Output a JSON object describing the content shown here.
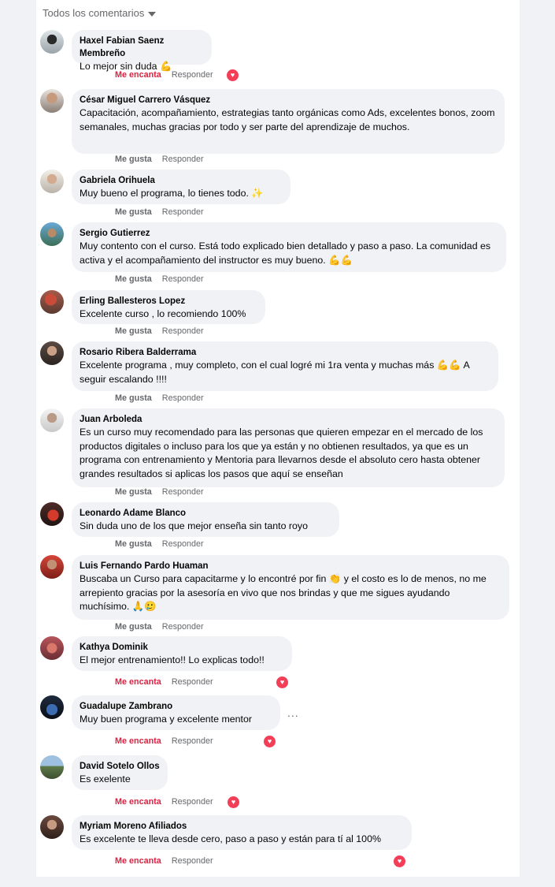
{
  "filter_label": "Todos los comentarios",
  "comments": [
    {
      "author": "Haxel Fabian Saenz Membreño",
      "text": "Lo mejor sin duda 💪",
      "like": "Me encanta",
      "reply": "Responder",
      "reaction": "love"
    },
    {
      "author": "César Miguel Carrero Vásquez",
      "text": "Capacitación, acompañamiento, estrategias tanto orgánicas como Ads, excelentes bonos, zoom semanales, muchas gracias por todo y ser parte del aprendizaje de muchos.",
      "like": "Me gusta",
      "reply": "Responder",
      "reaction": ""
    },
    {
      "author": "Gabriela Orihuela",
      "text": "Muy bueno el programa, lo tienes todo. ✨",
      "like": "Me gusta",
      "reply": "Responder",
      "reaction": ""
    },
    {
      "author": "Sergio Gutierrez",
      "text": "Muy contento con el curso. Está todo explicado bien detallado y paso a paso. La comunidad es activa y el acompañamiento del instructor es muy bueno. 💪💪",
      "like": "Me gusta",
      "reply": "Responder",
      "reaction": ""
    },
    {
      "author": "Erling Ballesteros Lopez",
      "text": "Excelente curso , lo recomiendo 100%",
      "like": "Me gusta",
      "reply": "Responder",
      "reaction": ""
    },
    {
      "author": "Rosario Ribera Balderrama",
      "text": "Excelente programa , muy completo, con el cual logré mi 1ra venta y muchas más 💪💪 A seguir escalando !!!!",
      "like": "Me gusta",
      "reply": "Responder",
      "reaction": ""
    },
    {
      "author": "Juan Arboleda",
      "text": "Es un curso muy recomendado para las personas que quieren empezar en el mercado de los productos digitales o incluso para los que ya están y no obtienen resultados, ya que es un programa con entrenamiento y Mentoria para llevarnos desde el absoluto cero hasta obtener grandes resultados si aplicas los pasos que aquí se enseñan",
      "like": "Me gusta",
      "reply": "Responder",
      "reaction": ""
    },
    {
      "author": "Leonardo Adame Blanco",
      "text": "Sin duda uno de los que mejor enseña sin tanto royo",
      "like": "Me gusta",
      "reply": "Responder",
      "reaction": ""
    },
    {
      "author": "Luis Fernando Pardo Huaman",
      "text": "Buscaba un Curso para capacitarme y lo encontré por fin 👏 y el costo es lo de menos, no me arrepiento gracias por la asesoría en vivo que nos brindas y que me sigues ayudando muchísimo. 🙏🥲",
      "like": "Me gusta",
      "reply": "Responder",
      "reaction": ""
    },
    {
      "author": "Kathya Dominik",
      "text": "El mejor entrenamiento!! Lo explicas todo!!",
      "like": "Me encanta",
      "reply": "Responder",
      "reaction": "love"
    },
    {
      "author": "Guadalupe Zambrano",
      "text": "Muy buen programa y excelente mentor",
      "like": "Me encanta",
      "reply": "Responder",
      "reaction": "love",
      "more": "..."
    },
    {
      "author": "David Sotelo Ollos",
      "text": "Es exelente",
      "like": "Me encanta",
      "reply": "Responder",
      "reaction": "love"
    },
    {
      "author": "Myriam Moreno Afiliados",
      "text": "Es excelente te lleva desde cero, paso a paso y están para tí al 100%",
      "like": "Me encanta",
      "reply": "Responder",
      "reaction": "love"
    }
  ]
}
